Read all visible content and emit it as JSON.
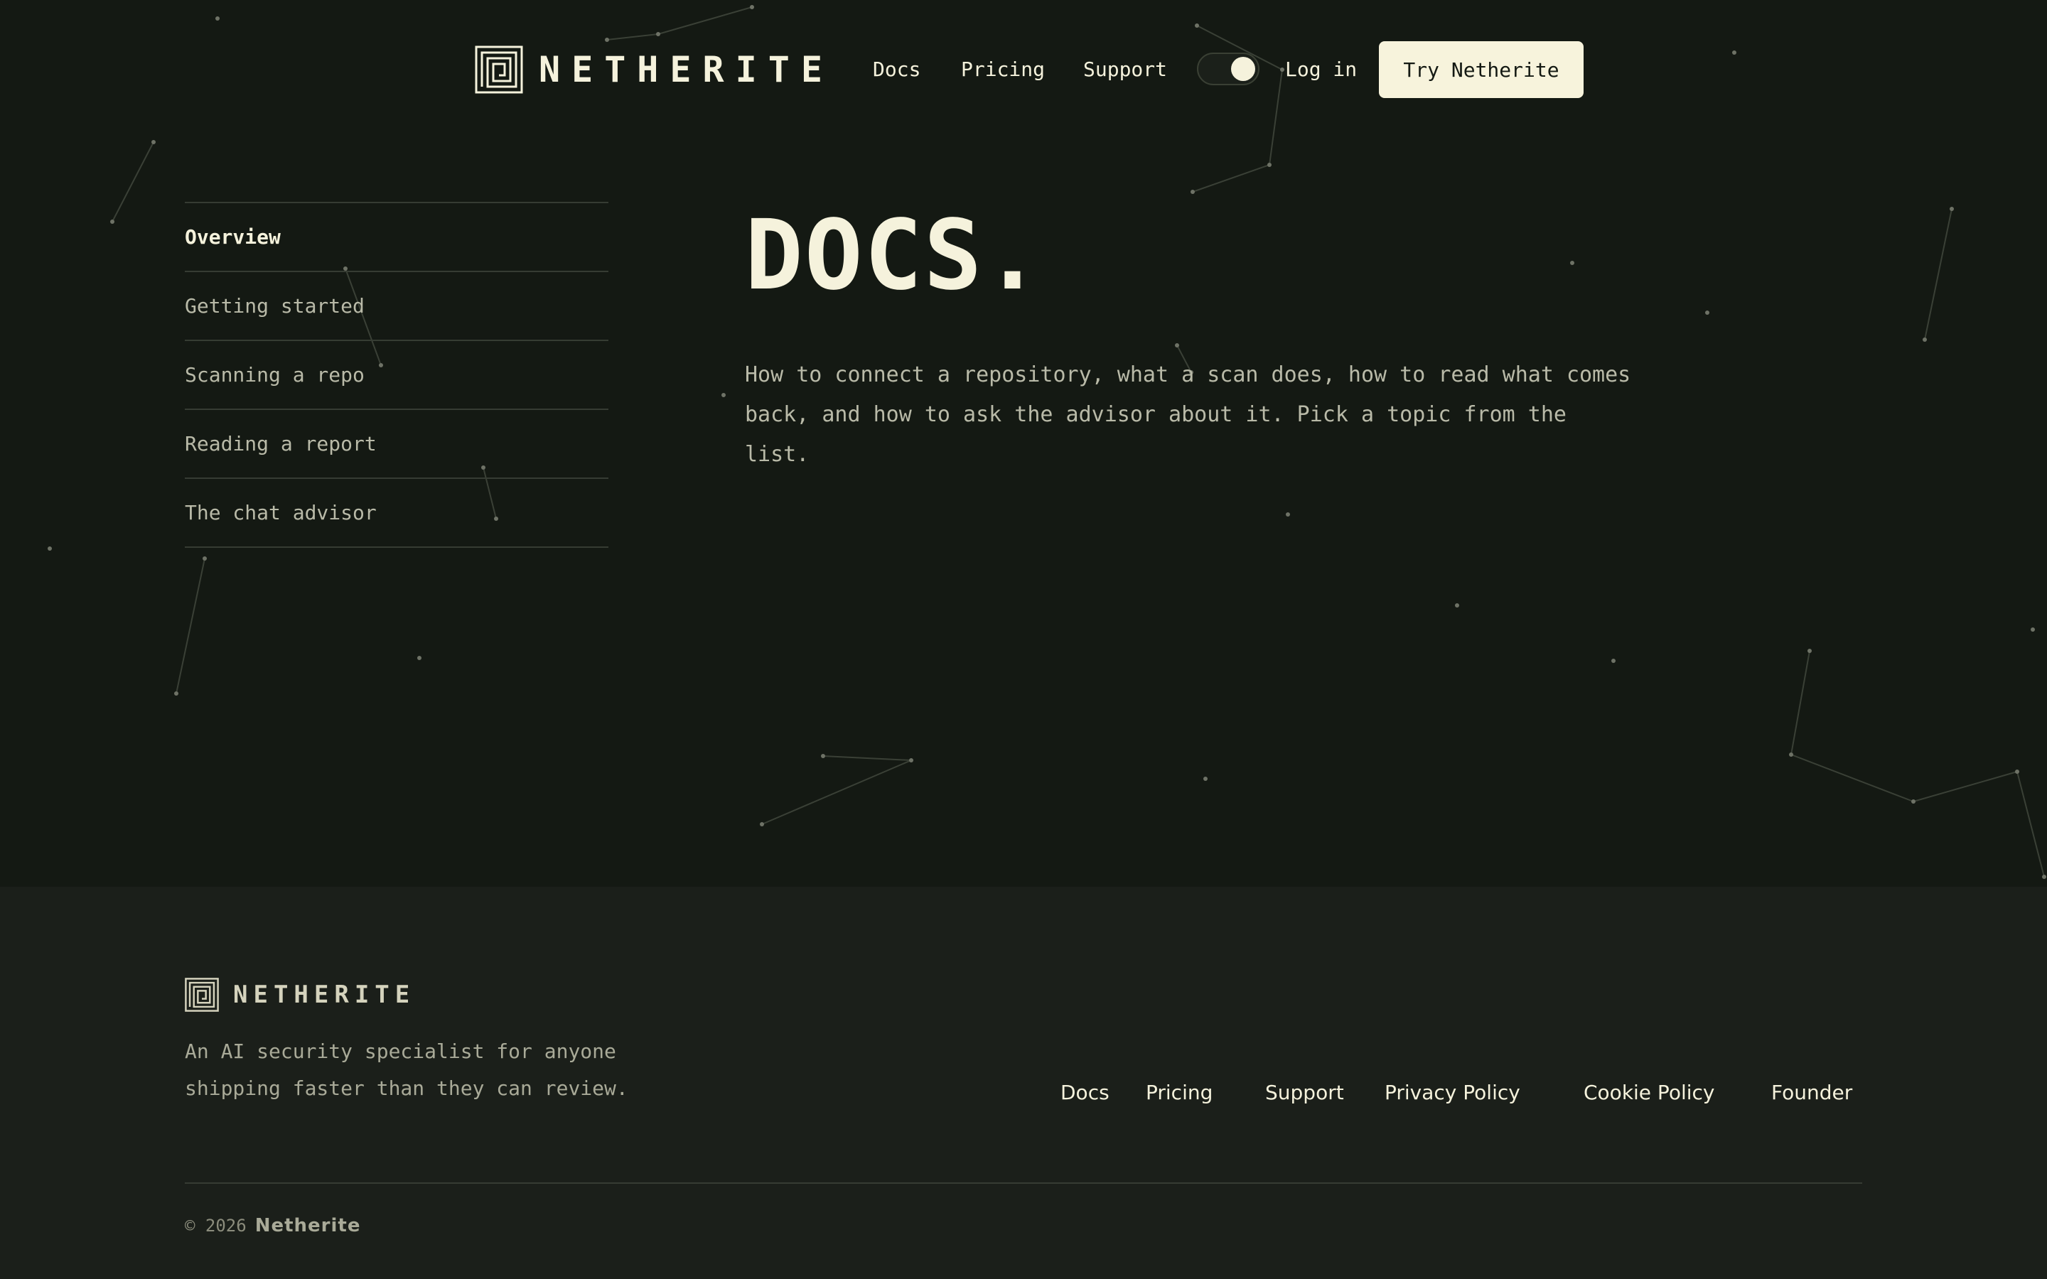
{
  "brand": {
    "name": "NETHERITE",
    "logo_icon": "maze-logo-icon"
  },
  "header": {
    "nav": [
      {
        "label": "Docs"
      },
      {
        "label": "Pricing"
      },
      {
        "label": "Support"
      }
    ],
    "theme_toggle": {
      "state": "on",
      "icon": "theme-toggle-icon"
    },
    "login_label": "Log in",
    "cta_label": "Try Netherite"
  },
  "sidebar": {
    "items": [
      {
        "label": "Overview",
        "active": true
      },
      {
        "label": "Getting started",
        "active": false
      },
      {
        "label": "Scanning a repo",
        "active": false
      },
      {
        "label": "Reading a report",
        "active": false
      },
      {
        "label": "The chat advisor",
        "active": false
      }
    ]
  },
  "main": {
    "title": "DOCS.",
    "intro": "How to connect a repository, what a scan does, how to read what comes back, and how to ask the advisor about it. Pick a topic from the list."
  },
  "footer": {
    "brand": "NETHERITE",
    "tagline": "An AI security specialist for anyone shipping faster than they can review.",
    "links": [
      {
        "label": "Docs"
      },
      {
        "label": "Pricing"
      },
      {
        "label": "Support"
      },
      {
        "label": "Privacy Policy"
      },
      {
        "label": "Cookie Policy"
      },
      {
        "label": "Founder"
      }
    ],
    "copyright_symbol": "© 2026",
    "copyright_brand": "Netherite"
  },
  "colors": {
    "background": "#141913",
    "footer_background": "#1b1f1a",
    "text": "#f5f2dc",
    "muted_text": "#b9baa8",
    "cta_background": "#f7f3dc",
    "divider": "#363c33"
  }
}
